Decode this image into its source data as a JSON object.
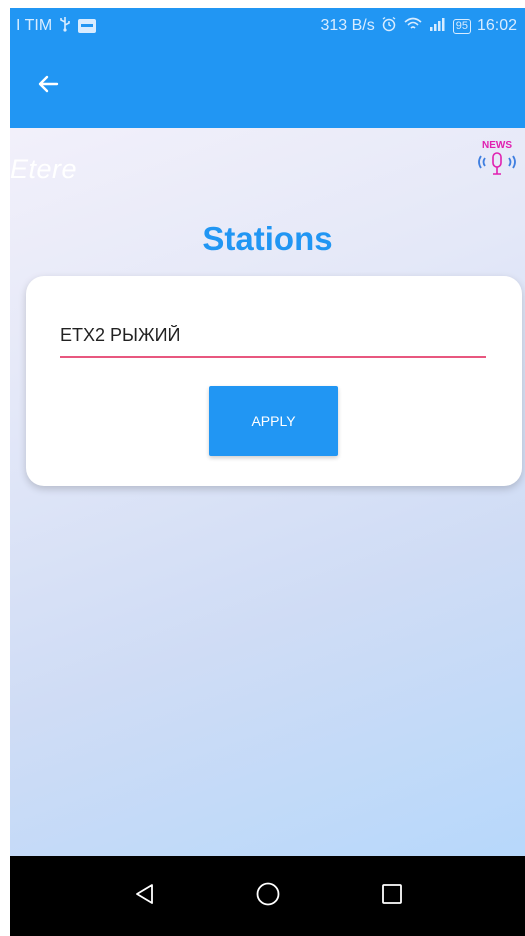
{
  "status_bar": {
    "carrier": "I TIM",
    "usb_icon": "usb-icon",
    "network_speed": "313 B/s",
    "battery": "95",
    "time": "16:02"
  },
  "app_bar": {
    "back_icon": "arrow-left-icon",
    "color": "#2196f3"
  },
  "main": {
    "brand": "Etere",
    "news_badge": "NEWS",
    "page_title": "Stations",
    "station_input_value": "ETX2 РЫЖИЙ",
    "apply_label": "APPLY"
  },
  "nav_bar": {
    "items": [
      "back-triangle-icon",
      "home-circle-icon",
      "recents-square-icon"
    ]
  },
  "colors": {
    "accent": "#2196f3",
    "underline": "#e8577f",
    "news_magenta": "#e020b0"
  }
}
